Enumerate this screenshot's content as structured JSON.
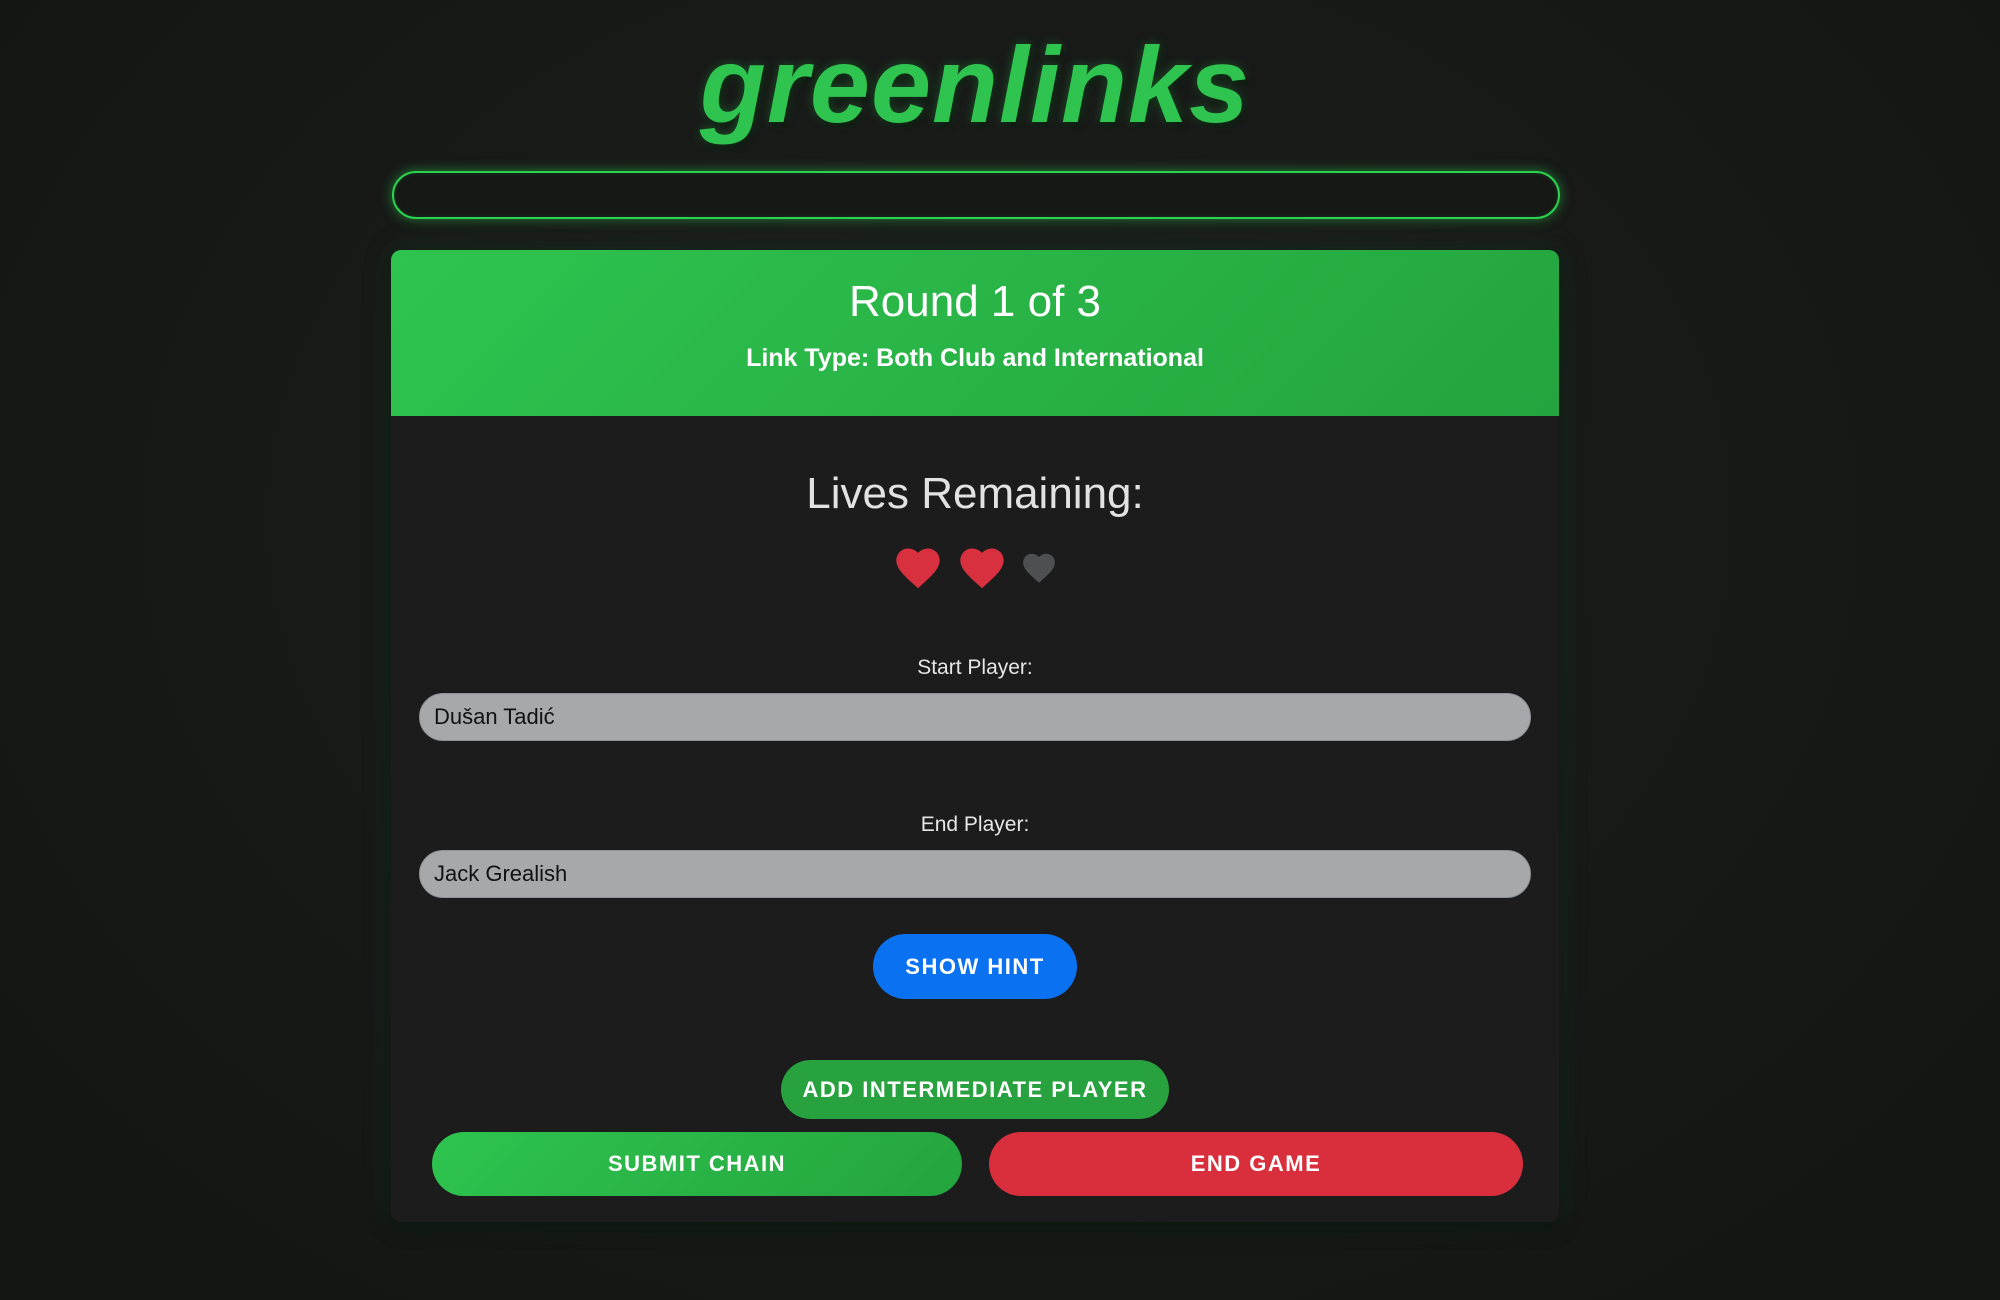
{
  "app": {
    "logo_text": "greenlinks"
  },
  "progress": {
    "fraction": 0
  },
  "round": {
    "title": "Round 1 of 3",
    "link_type": "Link Type: Both Club and International"
  },
  "lives": {
    "title": "Lives Remaining:",
    "remaining": 2,
    "total": 3,
    "active_color": "#d9303f",
    "lost_color": "#4d4f53"
  },
  "start_player": {
    "label": "Start Player:",
    "value": "Dušan Tadić"
  },
  "end_player": {
    "label": "End Player:",
    "value": "Jack Grealish"
  },
  "buttons": {
    "hint": "SHOW HINT",
    "add_intermediate": "ADD INTERMEDIATE PLAYER",
    "submit": "SUBMIT CHAIN",
    "end_game": "END GAME"
  },
  "colors": {
    "brand_green": "#2ec44f",
    "hint_blue": "#0a72f0",
    "end_red": "#d92f3c"
  }
}
